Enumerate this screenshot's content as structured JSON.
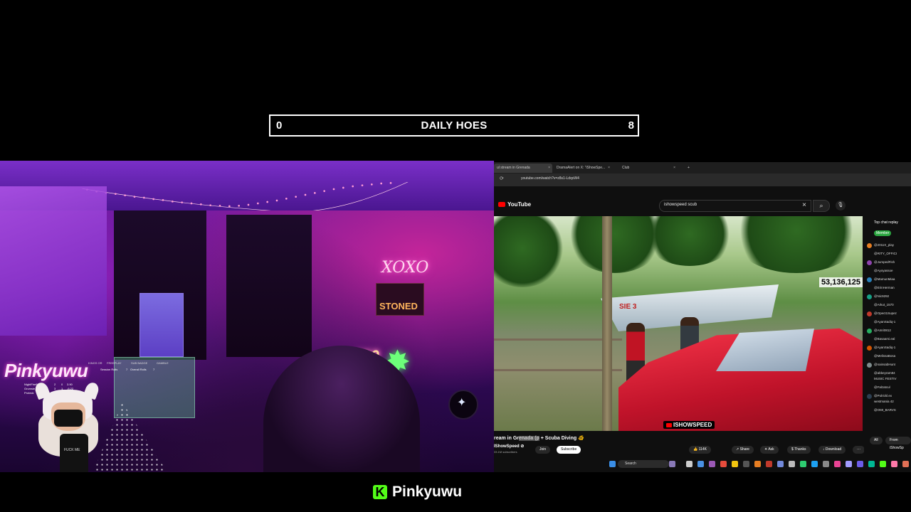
{
  "counter": {
    "left": "0",
    "title": "DAILY HOES",
    "right": "8"
  },
  "webcam": {
    "neon_xoxo": "XOXO",
    "neon_stoned": "STONED",
    "neon_420": "420",
    "overlay_name": "Pinkyuwu",
    "avatar_shirt_text": "FUCK ME",
    "leaderboard": {
      "headers": [
        "KINGS OR",
        "FREEPLAY",
        "SUB BADGE",
        "GAMBLE"
      ],
      "left_rows": [
        [
          "NightFire883",
          "2",
          "0",
          "3.90"
        ],
        [
          "Grumsie_lead",
          "3",
          "1",
          "-6.22"
        ],
        [
          "Proteck",
          "1",
          "4",
          ""
        ]
      ],
      "right_rows": [
        [
          "Session Rolls",
          "7"
        ],
        [
          "Overall Rolls",
          "7"
        ]
      ]
    },
    "strip_numbers": [
      "50",
      "55",
      "30",
      "70",
      "5",
      "10",
      "15",
      "20",
      "25",
      "30",
      "35",
      "40",
      "45",
      "50"
    ]
  },
  "browser": {
    "tabs": [
      {
        "label": "ul stream in Grenada"
      },
      {
        "label": "DramaAlert on X: \"iShowSpe..."
      },
      {
        "label": "Club"
      }
    ],
    "new_tab": "+",
    "url": "youtube.com/watch?v=z8s1-LdqxW4",
    "youtube_label": "YouTube",
    "search_query": "ishowspeed scub",
    "video": {
      "view_count": "53,136,125",
      "channel_badge": "ISHOWSPEED",
      "boat_text": "SIE 3"
    },
    "title_prefix": "ream in Gr",
    "title_highlight": "enada (p",
    "title_suffix": " + Scuba Diving 🐠",
    "channel_name": "IShowSpeed ⊘",
    "subscribers": "33.1M subscribers",
    "buttons": {
      "join": "Join",
      "subscribe": "Subscribe",
      "likes": "114K",
      "share": "Share",
      "ask": "Ask",
      "thanks": "Thanks",
      "download": "Download",
      "more": "···"
    },
    "taskbar_search": "Search",
    "chat": {
      "header": "Top chat replay",
      "member_label": "Member",
      "messages": [
        "@2011X_play",
        "@RITY_OFFICI",
        "@JumpedFish",
        "@Ayoyassoe",
        "@MamunMiaa",
        "@ErinHerman",
        "@Nic9292",
        "@Arkut_1570",
        "@Opect1Supez",
        "@AyanSadiq-1",
        "@Amri0812",
        "@Basaami.eal",
        "@AyanSadiq-1",
        "@MelissaBosa",
        "@nainsabHunt",
        "@abbeyram84",
        "MUSIC FESTIV",
        "@Falzatcul",
        "@Polrickl.ex",
        "westmania 42",
        "@OMI_BARVS"
      ],
      "filters": [
        "All",
        "From iShowSp"
      ]
    }
  },
  "branding": {
    "icon_letter": "K",
    "name": "Pinkyuwu"
  },
  "colors": {
    "kick_green": "#53fc18",
    "youtube_red": "#ff0000",
    "member_green": "#2ba640"
  }
}
